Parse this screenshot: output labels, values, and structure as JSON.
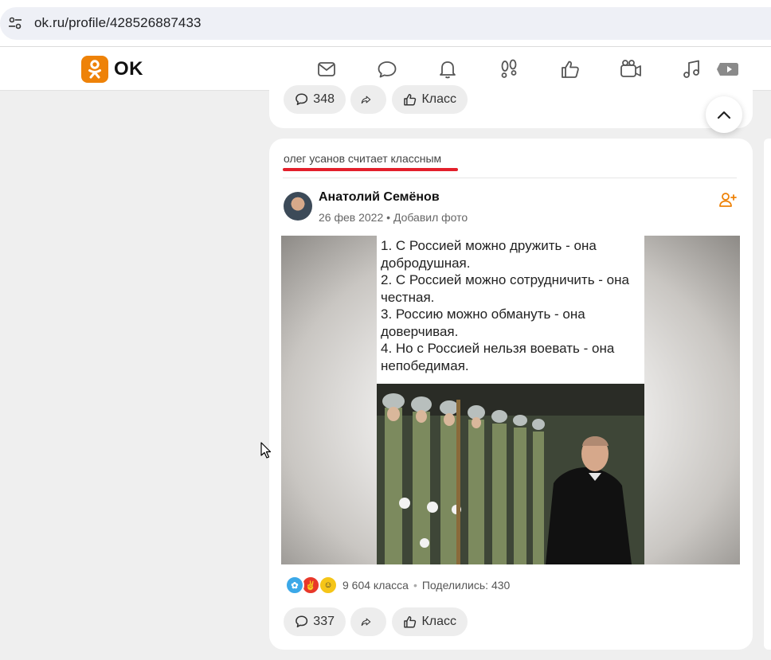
{
  "browser": {
    "url": "ok.ru/profile/428526887433",
    "site_icon": "tune-icon"
  },
  "header": {
    "logo_text": "OK",
    "brand_color": "#ee8208",
    "nav_icons": [
      "mail-icon",
      "chat-icon",
      "bell-icon",
      "footprints-icon",
      "thumbs-up-icon",
      "camera-icon",
      "music-icon",
      "video-icon"
    ]
  },
  "previous_post": {
    "comments_count": "348",
    "class_label": "Класс"
  },
  "post": {
    "activity": "олег усанов считает классным",
    "author": "Анатолий Семёнов",
    "date": "26 фев 2022",
    "separator": "•",
    "action": "Добавил фото",
    "image_text": [
      "1. С Россией можно дружить - она добродушная.",
      "2. С Россией можно сотрудничить - она честная.",
      "3. Россию можно обмануть - она доверчивая.",
      "4. Но с Россией нельзя воевать - она непобедимая."
    ],
    "classes": "9 604 класса",
    "shares": "Поделились: 430",
    "comments_count": "337",
    "class_label": "Класс",
    "accent_color": "#e3202b"
  }
}
